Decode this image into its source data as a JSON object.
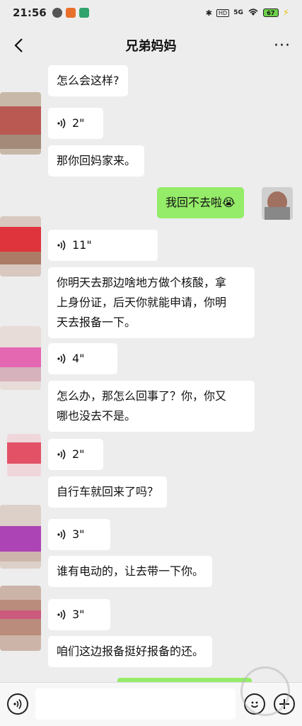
{
  "status_bar": {
    "time": "21:56",
    "network": "5G",
    "battery": "67",
    "hd": "HD"
  },
  "header": {
    "title": "兄弟妈妈",
    "more": "···"
  },
  "messages": [
    {
      "type": "text",
      "direction": "in",
      "text": "怎么会这样?"
    },
    {
      "type": "voice",
      "direction": "in",
      "duration": "2\""
    },
    {
      "type": "text",
      "direction": "in",
      "text": "那你回妈家来。"
    },
    {
      "type": "text",
      "direction": "out",
      "text": "我回不去啦😭"
    },
    {
      "type": "voice",
      "direction": "in",
      "duration": "11\""
    },
    {
      "type": "text",
      "direction": "in",
      "lines": [
        "你明天去那边啥地方做个核酸，拿",
        "上身份证，后天你就能申请，你明",
        "天去报备一下。"
      ]
    },
    {
      "type": "voice",
      "direction": "in",
      "duration": "4\""
    },
    {
      "type": "text",
      "direction": "in",
      "lines": [
        "怎么办，那怎么回事了？你，你又",
        "哪也没去不是。"
      ]
    },
    {
      "type": "voice",
      "direction": "in",
      "duration": "2\""
    },
    {
      "type": "text",
      "direction": "in",
      "text": "自行车就回来了吗？"
    },
    {
      "type": "voice",
      "direction": "in",
      "duration": "3\""
    },
    {
      "type": "text",
      "direction": "in",
      "text": "谁有电动的，让去带一下你。"
    },
    {
      "type": "voice",
      "direction": "in",
      "duration": "3\""
    },
    {
      "type": "text",
      "direction": "in",
      "text": "咱们这边报备挺好报备的还。"
    }
  ],
  "colors": {
    "background": "#ededed",
    "outgoing_bubble": "#95ec69",
    "incoming_bubble": "#ffffff"
  }
}
